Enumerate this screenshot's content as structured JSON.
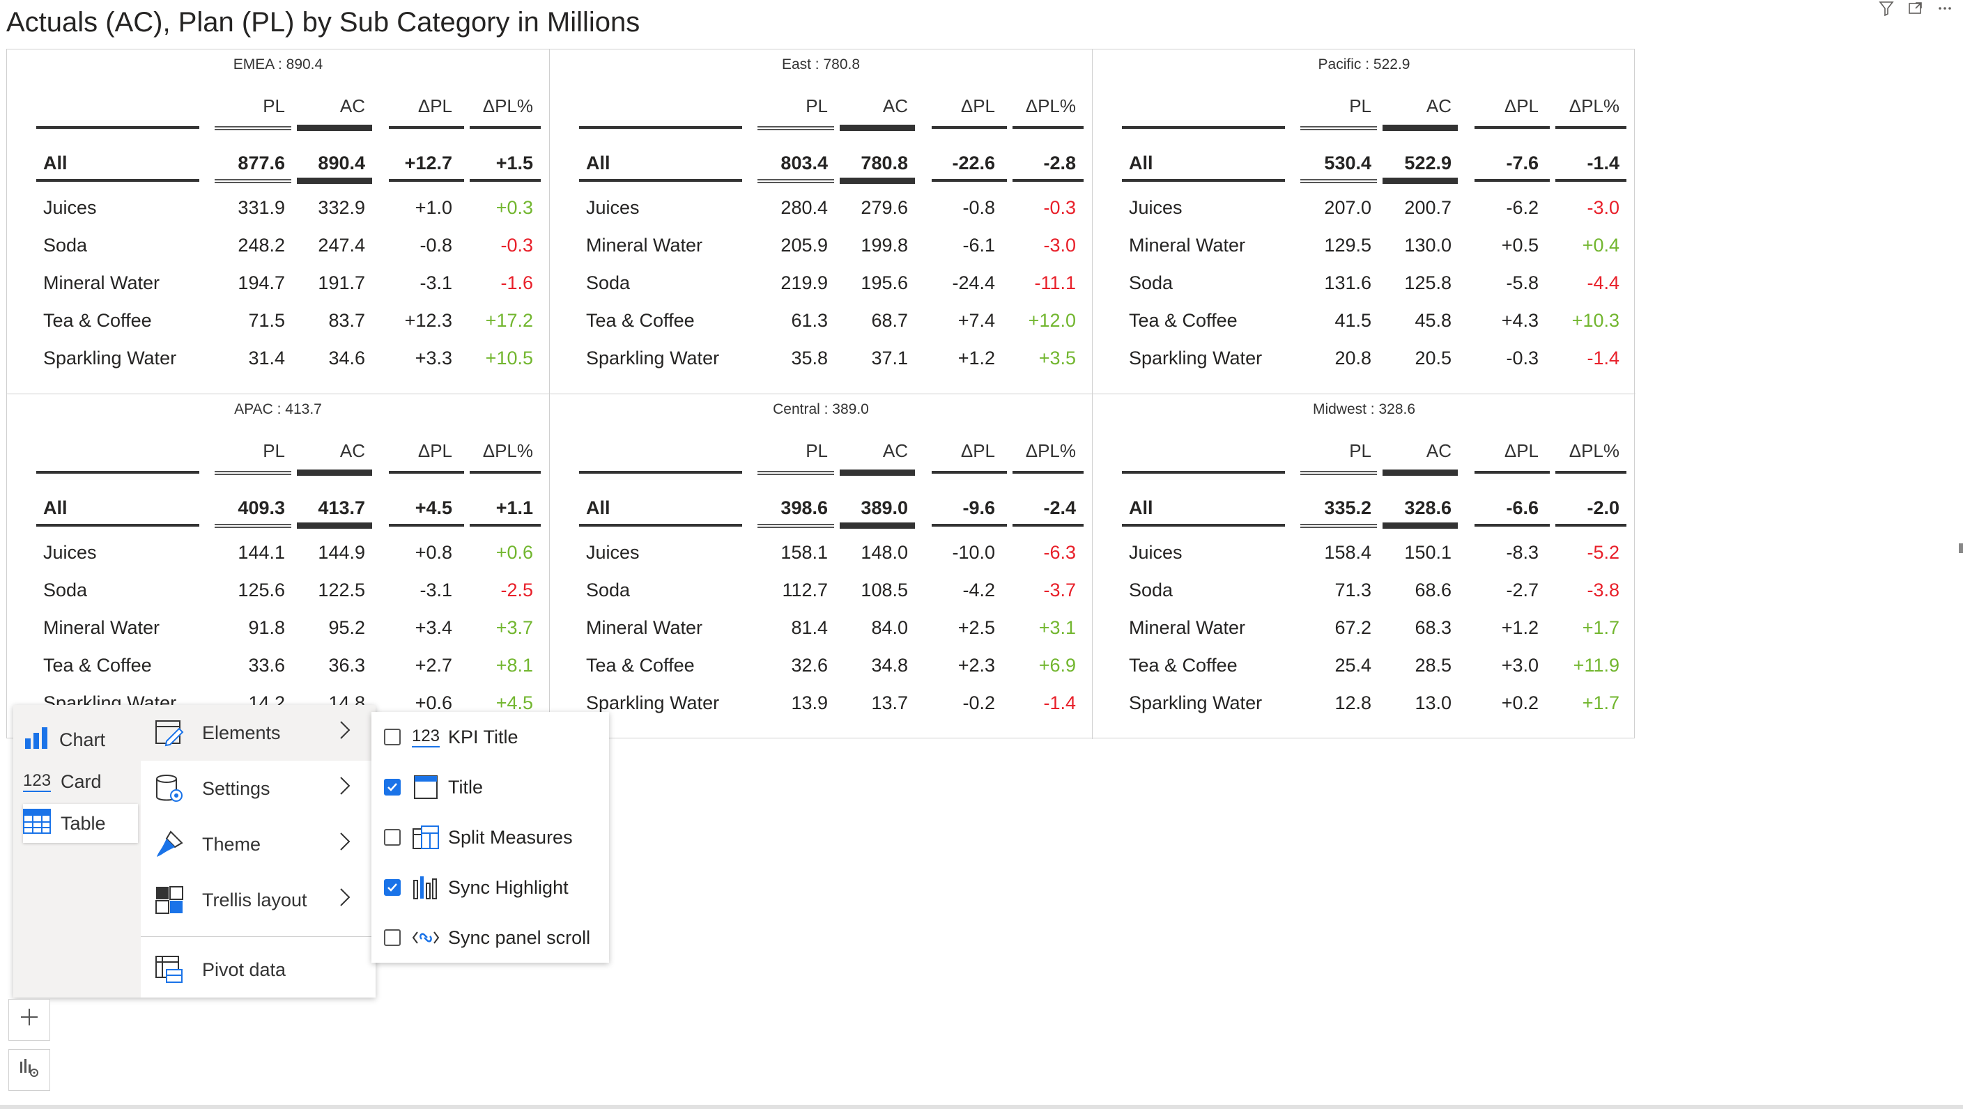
{
  "title": "Actuals (AC), Plan (PL) by Sub Category in Millions",
  "header_icons": [
    "filter-icon",
    "focus-mode-icon",
    "more-options-icon"
  ],
  "columns": {
    "pl": "PL",
    "ac": "AC",
    "dpl": "ΔPL",
    "dplp": "ΔPL%"
  },
  "colors": {
    "positive": "#72b62f",
    "negative": "#e8202a",
    "accent": "#1a73e8"
  },
  "panels": [
    {
      "name": "EMEA",
      "label": "EMEA :  890.4",
      "all": {
        "label": "All",
        "pl": "877.6",
        "ac": "890.4",
        "dpl": "+12.7",
        "dplp": "+1.5"
      },
      "rows": [
        {
          "label": "Juices",
          "pl": "331.9",
          "ac": "332.9",
          "dpl": "+1.0",
          "dplp": "+0.3"
        },
        {
          "label": "Soda",
          "pl": "248.2",
          "ac": "247.4",
          "dpl": "-0.8",
          "dplp": "-0.3"
        },
        {
          "label": "Mineral Water",
          "pl": "194.7",
          "ac": "191.7",
          "dpl": "-3.1",
          "dplp": "-1.6"
        },
        {
          "label": "Tea & Coffee",
          "pl": "71.5",
          "ac": "83.7",
          "dpl": "+12.3",
          "dplp": "+17.2"
        },
        {
          "label": "Sparkling Water",
          "pl": "31.4",
          "ac": "34.6",
          "dpl": "+3.3",
          "dplp": "+10.5"
        }
      ]
    },
    {
      "name": "East",
      "label": "East :  780.8",
      "all": {
        "label": "All",
        "pl": "803.4",
        "ac": "780.8",
        "dpl": "-22.6",
        "dplp": "-2.8"
      },
      "rows": [
        {
          "label": "Juices",
          "pl": "280.4",
          "ac": "279.6",
          "dpl": "-0.8",
          "dplp": "-0.3"
        },
        {
          "label": "Mineral Water",
          "pl": "205.9",
          "ac": "199.8",
          "dpl": "-6.1",
          "dplp": "-3.0"
        },
        {
          "label": "Soda",
          "pl": "219.9",
          "ac": "195.6",
          "dpl": "-24.4",
          "dplp": "-11.1"
        },
        {
          "label": "Tea & Coffee",
          "pl": "61.3",
          "ac": "68.7",
          "dpl": "+7.4",
          "dplp": "+12.0"
        },
        {
          "label": "Sparkling Water",
          "pl": "35.8",
          "ac": "37.1",
          "dpl": "+1.2",
          "dplp": "+3.5"
        }
      ]
    },
    {
      "name": "Pacific",
      "label": "Pacific :  522.9",
      "all": {
        "label": "All",
        "pl": "530.4",
        "ac": "522.9",
        "dpl": "-7.6",
        "dplp": "-1.4"
      },
      "rows": [
        {
          "label": "Juices",
          "pl": "207.0",
          "ac": "200.7",
          "dpl": "-6.2",
          "dplp": "-3.0"
        },
        {
          "label": "Mineral Water",
          "pl": "129.5",
          "ac": "130.0",
          "dpl": "+0.5",
          "dplp": "+0.4"
        },
        {
          "label": "Soda",
          "pl": "131.6",
          "ac": "125.8",
          "dpl": "-5.8",
          "dplp": "-4.4"
        },
        {
          "label": "Tea & Coffee",
          "pl": "41.5",
          "ac": "45.8",
          "dpl": "+4.3",
          "dplp": "+10.3"
        },
        {
          "label": "Sparkling Water",
          "pl": "20.8",
          "ac": "20.5",
          "dpl": "-0.3",
          "dplp": "-1.4"
        }
      ]
    },
    {
      "name": "APAC",
      "label": "APAC :  413.7",
      "all": {
        "label": "All",
        "pl": "409.3",
        "ac": "413.7",
        "dpl": "+4.5",
        "dplp": "+1.1"
      },
      "rows": [
        {
          "label": "Juices",
          "pl": "144.1",
          "ac": "144.9",
          "dpl": "+0.8",
          "dplp": "+0.6"
        },
        {
          "label": "Soda",
          "pl": "125.6",
          "ac": "122.5",
          "dpl": "-3.1",
          "dplp": "-2.5"
        },
        {
          "label": "Mineral Water",
          "pl": "91.8",
          "ac": "95.2",
          "dpl": "+3.4",
          "dplp": "+3.7"
        },
        {
          "label": "Tea & Coffee",
          "pl": "33.6",
          "ac": "36.3",
          "dpl": "+2.7",
          "dplp": "+8.1"
        },
        {
          "label": "Sparkling Water",
          "pl": "14.2",
          "ac": "14.8",
          "dpl": "+0.6",
          "dplp": "+4.5"
        }
      ]
    },
    {
      "name": "Central",
      "label": "Central :  389.0",
      "all": {
        "label": "All",
        "pl": "398.6",
        "ac": "389.0",
        "dpl": "-9.6",
        "dplp": "-2.4"
      },
      "rows": [
        {
          "label": "Juices",
          "pl": "158.1",
          "ac": "148.0",
          "dpl": "-10.0",
          "dplp": "-6.3"
        },
        {
          "label": "Soda",
          "pl": "112.7",
          "ac": "108.5",
          "dpl": "-4.2",
          "dplp": "-3.7"
        },
        {
          "label": "Mineral Water",
          "pl": "81.4",
          "ac": "84.0",
          "dpl": "+2.5",
          "dplp": "+3.1"
        },
        {
          "label": "Tea & Coffee",
          "pl": "32.6",
          "ac": "34.8",
          "dpl": "+2.3",
          "dplp": "+6.9"
        },
        {
          "label": "Sparkling Water",
          "pl": "13.9",
          "ac": "13.7",
          "dpl": "-0.2",
          "dplp": "-1.4"
        }
      ]
    },
    {
      "name": "Midwest",
      "label": "Midwest :  328.6",
      "all": {
        "label": "All",
        "pl": "335.2",
        "ac": "328.6",
        "dpl": "-6.6",
        "dplp": "-2.0"
      },
      "rows": [
        {
          "label": "Juices",
          "pl": "158.4",
          "ac": "150.1",
          "dpl": "-8.3",
          "dplp": "-5.2"
        },
        {
          "label": "Soda",
          "pl": "71.3",
          "ac": "68.6",
          "dpl": "-2.7",
          "dplp": "-3.8"
        },
        {
          "label": "Mineral Water",
          "pl": "67.2",
          "ac": "68.3",
          "dpl": "+1.2",
          "dplp": "+1.7"
        },
        {
          "label": "Tea & Coffee",
          "pl": "25.4",
          "ac": "28.5",
          "dpl": "+3.0",
          "dplp": "+11.9"
        },
        {
          "label": "Sparkling Water",
          "pl": "12.8",
          "ac": "13.0",
          "dpl": "+0.2",
          "dplp": "+1.7"
        }
      ]
    }
  ],
  "visual_types": [
    {
      "label": "Chart",
      "icon": "bar-chart-icon",
      "selected": false
    },
    {
      "label": "Card",
      "icon": "card-123-icon",
      "selected": false
    },
    {
      "label": "Table",
      "icon": "table-icon",
      "selected": true
    }
  ],
  "menu": [
    {
      "label": "Elements",
      "icon": "elements-edit-icon",
      "submenu": true,
      "active": true
    },
    {
      "label": "Settings",
      "icon": "settings-database-icon",
      "submenu": true,
      "active": false
    },
    {
      "label": "Theme",
      "icon": "paintbrush-icon",
      "submenu": true,
      "active": false
    },
    {
      "label": "Trellis layout",
      "icon": "trellis-grid-icon",
      "submenu": true,
      "active": false
    },
    {
      "label": "Pivot data",
      "icon": "pivot-table-icon",
      "submenu": false,
      "active": false
    }
  ],
  "elements_submenu": [
    {
      "label": "KPI Title",
      "icon": "kpi-123-icon",
      "checked": false
    },
    {
      "label": "Title",
      "icon": "title-window-icon",
      "checked": true
    },
    {
      "label": "Split Measures",
      "icon": "split-measures-icon",
      "checked": false
    },
    {
      "label": "Sync Highlight",
      "icon": "sync-highlight-icon",
      "checked": true
    },
    {
      "label": "Sync panel scroll",
      "icon": "sync-scroll-link-icon",
      "checked": false
    }
  ],
  "side_buttons": [
    {
      "icon": "plus-icon",
      "label": "+"
    },
    {
      "icon": "chart-settings-icon",
      "label": ""
    }
  ]
}
